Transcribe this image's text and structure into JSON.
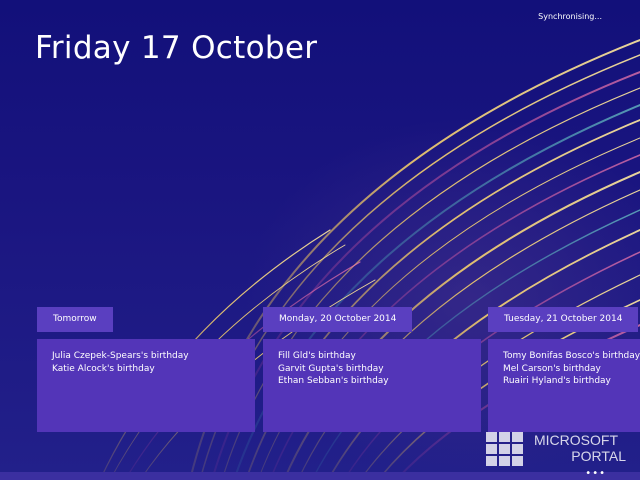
{
  "status": {
    "sync_text": "Synchronising..."
  },
  "header": {
    "date_title": "Friday 17 October"
  },
  "agenda": [
    {
      "heading": "Tomorrow",
      "events": [
        "Julia Czepek-Spears's birthday",
        "Katie Alcock's birthday"
      ]
    },
    {
      "heading": "Monday, 20 October 2014",
      "events": [
        "Fill Gld's birthday",
        "Garvit Gupta's birthday",
        "Ethan Sebban's birthday"
      ]
    },
    {
      "heading": "Tuesday, 21 October 2014",
      "events": [
        "Tomy Bonifas Bosco's birthday",
        "Mel Carson's birthday",
        "Ruairi Hyland's birthday"
      ]
    }
  ],
  "watermark": {
    "line1": "MICROSOFT",
    "line2": "PORTAL"
  },
  "appbar": {
    "more_icon": "more-icon"
  },
  "colors": {
    "background": "#16127a",
    "tile": "#5335b8",
    "tile_header": "#5a3fc0"
  }
}
